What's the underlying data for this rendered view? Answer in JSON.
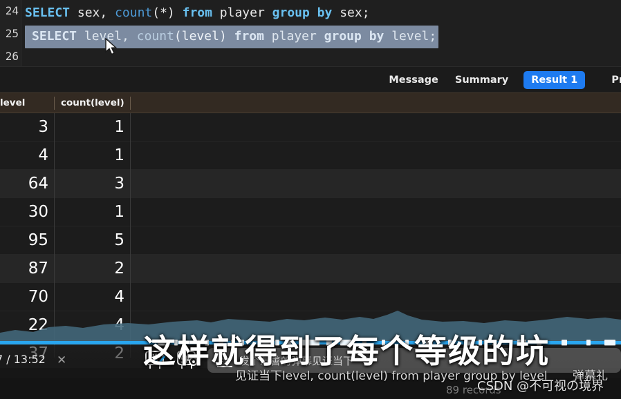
{
  "editor": {
    "line_numbers": [
      "24",
      "25",
      "26"
    ],
    "line24": {
      "t1": "SELECT",
      "t2": " sex,",
      "t3": " count",
      "t4": "(*)",
      "t5": " from",
      "t6": " player",
      "t7": " group",
      "t8": " by",
      "t9": " sex;"
    },
    "line25": {
      "t1": "SELECT",
      "t2": " level,",
      "t3": " count",
      "t4": "(level)",
      "t5": " from",
      "t6": " player",
      "t7": " group",
      "t8": " by",
      "t9": " level;"
    },
    "cursor_icon": "mouse-pointer-icon"
  },
  "results_toolbar": {
    "tabs": [
      {
        "label": "Message",
        "active": false
      },
      {
        "label": "Summary",
        "active": false
      },
      {
        "label": "Result 1",
        "active": true
      },
      {
        "label": "Pro",
        "active": false
      }
    ],
    "active_accent": "#1e7bf0"
  },
  "grid": {
    "columns": [
      "level",
      "count(level)"
    ],
    "header_bg": "#332a22",
    "rows": [
      {
        "level": "3",
        "count": "1"
      },
      {
        "level": "4",
        "count": "1"
      },
      {
        "level": "64",
        "count": "3"
      },
      {
        "level": "30",
        "count": "1"
      },
      {
        "level": "95",
        "count": "5"
      },
      {
        "level": "87",
        "count": "2"
      },
      {
        "level": "70",
        "count": "4"
      },
      {
        "level": "22",
        "count": "4"
      },
      {
        "level": "37",
        "count": "2"
      }
    ],
    "record_count": "89 records"
  },
  "player": {
    "time_display": "7 / 13:52",
    "close_label": "✕",
    "progress_color": "#29a6f0",
    "danmaku_toggle_icon": "danmaku-on-icon",
    "danmaku_settings_icon": "danmaku-settings-icon",
    "style_icon": "text-style-icon",
    "input_placeholder": "发个友善的弹幕见证当下",
    "subtitle": "这样就得到了每个等级的坑",
    "danmaku_comments": [
      "见证当下level, count(level) from player group by level",
      "弹幕礼"
    ],
    "watermark": "CSDN @不可视の境界"
  }
}
